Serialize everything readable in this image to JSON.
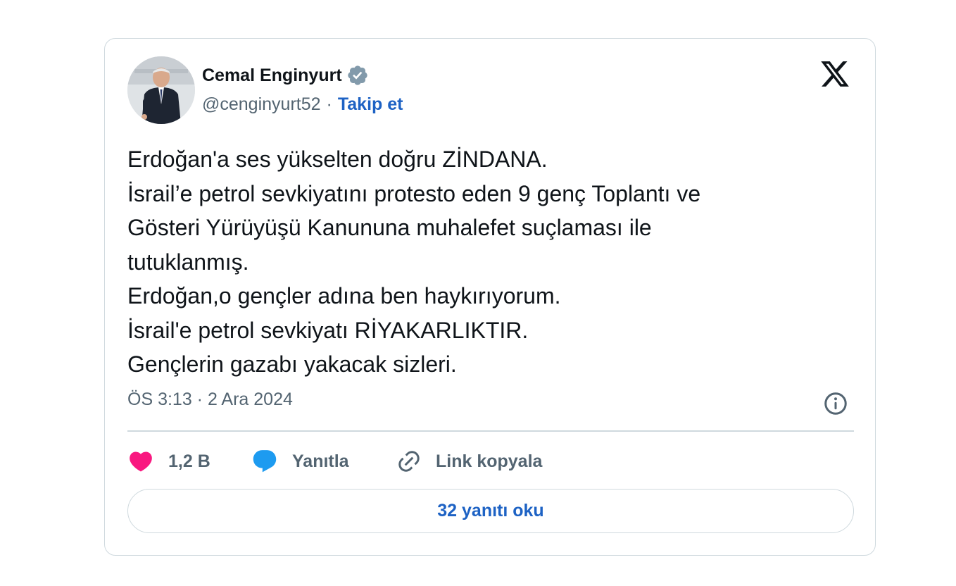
{
  "author": {
    "display_name": "Cemal Enginyurt",
    "handle": "@cenginyurt52",
    "separator": "·",
    "follow_label": "Takip et",
    "avatar_icon": "profile-photo",
    "verified_icon": "verified-badge-icon"
  },
  "tweet": {
    "lines": [
      "Erdoğan'a ses yükselten doğru ZİNDANA.",
      "İsrail’e petrol sevkiyatını protesto eden 9 genç Toplantı ve",
      "Gösteri Yürüyüşü Kanununa muhalefet suçlaması ile",
      "tutuklanmış.",
      "Erdoğan,o gençler adına ben haykırıyorum.",
      "İsrail'e petrol sevkiyatı RİYAKARLIKTIR.",
      "Gençlerin gazabı yakacak sizleri."
    ],
    "timestamp": "ÖS 3:13 · 2 Ara 2024"
  },
  "actions": {
    "like_count": "1,2 B",
    "reply_label": "Yanıtla",
    "copy_link_label": "Link kopyala"
  },
  "read_replies_label": "32 yanıtı oku",
  "colors": {
    "text": "#0f1419",
    "secondary": "#536471",
    "link": "#1d62c4",
    "like": "#f91880",
    "reply": "#1d9bf0",
    "border": "#cfd9de",
    "verified_badge": "#829aab"
  }
}
